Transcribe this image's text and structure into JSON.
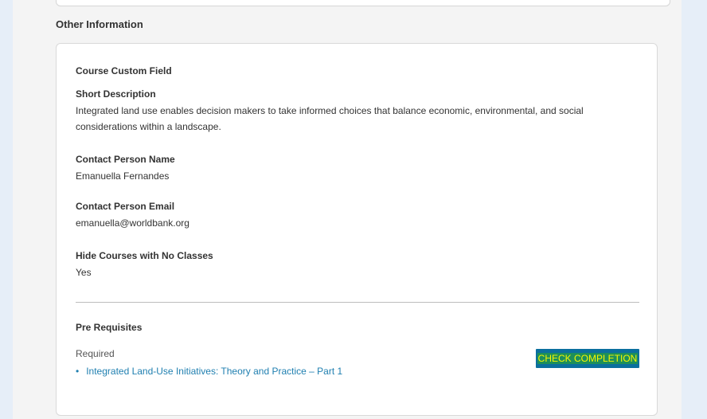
{
  "section": {
    "title": "Other Information"
  },
  "custom_fields": {
    "heading": "Course Custom Field",
    "short_description_label": "Short Description",
    "short_description_value": "Integrated land use enables decision makers to take informed choices that balance economic, environmental, and social considerations within a landscape.",
    "contact_name_label": "Contact Person Name",
    "contact_name_value": "Emanuella Fernandes",
    "contact_email_label": "Contact Person Email",
    "contact_email_value": "emanuella@worldbank.org",
    "hide_courses_label": "Hide Courses with No Classes",
    "hide_courses_value": "Yes"
  },
  "prerequisites": {
    "heading": "Pre Requisites",
    "required_label": "Required",
    "items": [
      {
        "bullet": "•",
        "label": "Integrated Land-Use Initiatives: Theory and Practice – Part 1"
      }
    ],
    "check_button_label": "CHECK COMPLETION"
  },
  "colors": {
    "background": "#e6eef8",
    "link": "#1f7fb0",
    "button": "#0b6f9e",
    "button_text": "#f7f700"
  }
}
